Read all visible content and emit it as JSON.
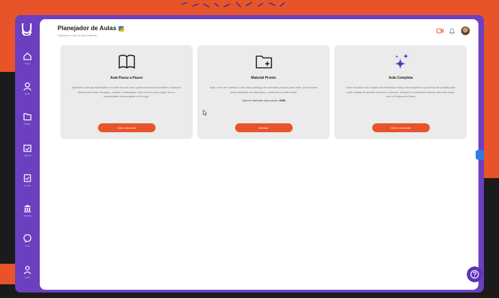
{
  "colors": {
    "accent": "#e8542a",
    "sidebar": "#6c3fc1",
    "card_bg": "#ebebeb",
    "fab": "#5b35b8"
  },
  "sidebar": {
    "logo_icon": "brand-logo-icon",
    "items": [
      {
        "label": "Início",
        "icon": "home-icon"
      },
      {
        "label": "Aulas",
        "icon": "teacher-icon"
      },
      {
        "label": "Pastas",
        "icon": "folder-icon"
      },
      {
        "label": "Agenda",
        "icon": "calendar-icon"
      },
      {
        "label": "Provas",
        "icon": "checklist-icon"
      },
      {
        "label": "Material",
        "icon": "bank-icon"
      },
      {
        "label": "Chat",
        "icon": "chat-icon"
      },
      {
        "label": "Conta",
        "icon": "user-icon"
      }
    ]
  },
  "header": {
    "title": "Planejador de Aulas",
    "subtitle": "Selecione o tipo do seu material"
  },
  "cards": [
    {
      "icon": "book-icon",
      "title": "Aula Passo a Passo",
      "description": "Aprimore suas apresentações em sala de aula com quadros brancos interativos. Adicione facilmente textos, imagens, vídeos e destaques, tudo em um único lugar, sem a necessidade de pesquisar no Google.",
      "button": "Criar nova aula"
    },
    {
      "icon": "folder-plus-icon",
      "title": "Material Pronto",
      "description": "Aqui, você tem acesso a um vasto catálogo de materiais prontos para você, que incluem uma variedade de atividades, conteúdos e muito mais!",
      "extra_label": "Total de materiais disponíveis:",
      "extra_value": "4196",
      "button": "Acessar"
    },
    {
      "icon": "sparkles-icon",
      "title": "Aula Completa",
      "description": "Gere sua aula com a ajuda da Professora Stacy. Ela simplifica o processo de criação para você, bastando apenas informar o assunto. Desperte o potencial máximo das suas aulas com a Professora Stacy!",
      "button": "Gerar nova aula"
    }
  ]
}
